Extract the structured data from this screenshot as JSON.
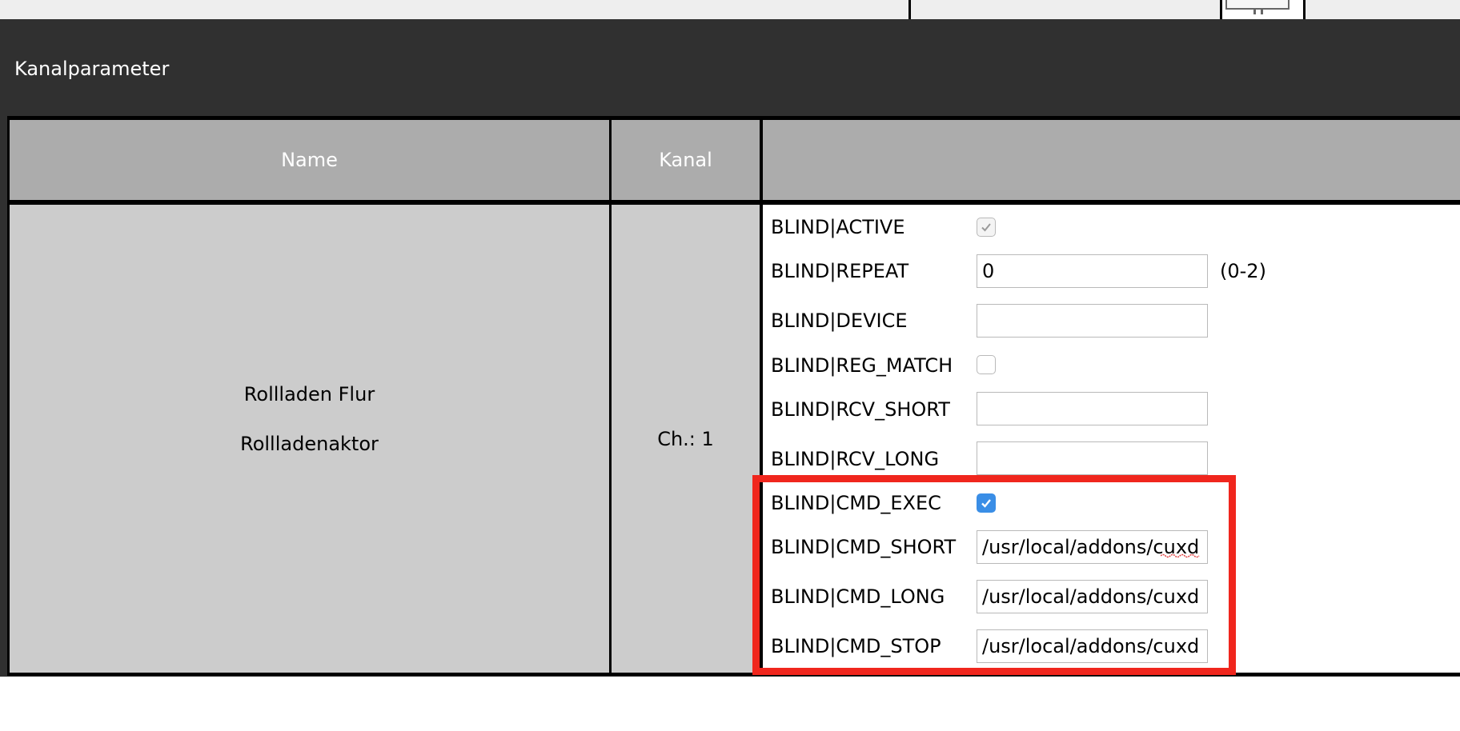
{
  "section_title": "Kanalparameter",
  "table": {
    "headers": {
      "name": "Name",
      "channel": "Kanal",
      "params": ""
    },
    "row": {
      "device_name": "Rollladen Flur",
      "device_type": "Rollladenaktor",
      "channel": "Ch.: 1"
    }
  },
  "params": {
    "active": {
      "label": "BLIND|ACTIVE",
      "checked": true,
      "disabled": true
    },
    "repeat": {
      "label": "BLIND|REPEAT",
      "value": "0",
      "range": "(0-2)"
    },
    "device": {
      "label": "BLIND|DEVICE",
      "value": ""
    },
    "reg_match": {
      "label": "BLIND|REG_MATCH",
      "checked": false
    },
    "rcv_short": {
      "label": "BLIND|RCV_SHORT",
      "value": ""
    },
    "rcv_long": {
      "label": "BLIND|RCV_LONG",
      "value": ""
    },
    "cmd_exec": {
      "label": "BLIND|CMD_EXEC",
      "checked": true
    },
    "cmd_short": {
      "label": "BLIND|CMD_SHORT",
      "value": "/usr/local/addons/cuxd"
    },
    "cmd_long": {
      "label": "BLIND|CMD_LONG",
      "value": "/usr/local/addons/cuxd"
    },
    "cmd_stop": {
      "label": "BLIND|CMD_STOP",
      "value": "/usr/local/addons/cuxd"
    }
  },
  "colors": {
    "highlight": "#f0261d",
    "checkbox_checked": "#3a8ee6",
    "header_bg": "#acacac",
    "panel_dark": "#303030"
  }
}
